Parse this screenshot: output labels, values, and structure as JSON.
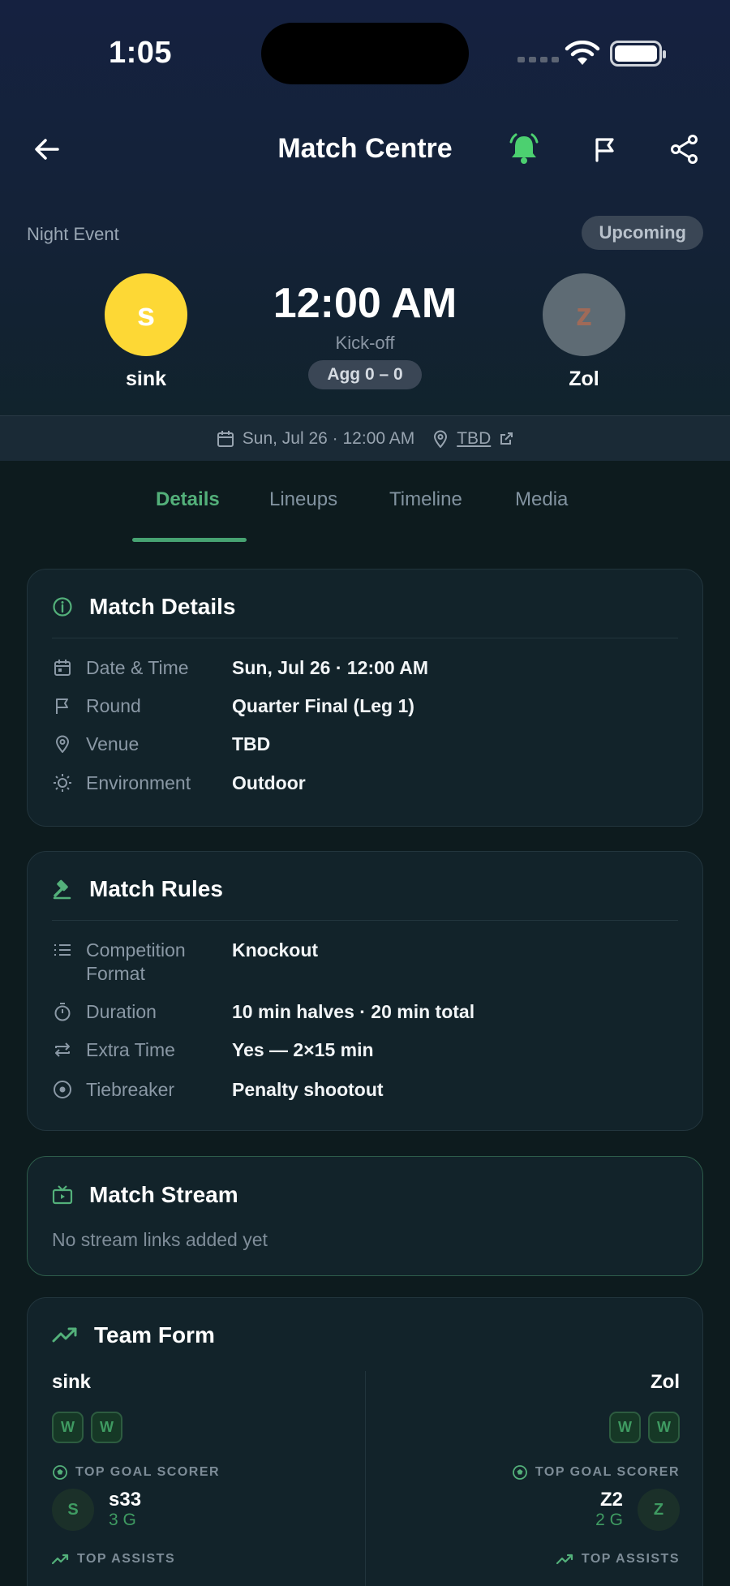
{
  "status_bar": {
    "time": "1:05"
  },
  "header": {
    "title": "Match Centre"
  },
  "hero": {
    "event_label": "Night Event",
    "status": "Upcoming",
    "home": {
      "initial": "s",
      "name": "sink",
      "crest_color": "#fdd835"
    },
    "away": {
      "initial": "z",
      "name": "Zol",
      "crest_color": "#5e6b74"
    },
    "kickoff_time": "12:00 AM",
    "kickoff_label": "Kick-off",
    "aggregate": "Agg 0 – 0"
  },
  "meta": {
    "datetime": "Sun, Jul 26 · 12:00 AM",
    "venue": "TBD"
  },
  "tabs": [
    {
      "label": "Details",
      "active": true
    },
    {
      "label": "Lineups"
    },
    {
      "label": "Timeline"
    },
    {
      "label": "Media"
    }
  ],
  "match_details": {
    "title": "Match Details",
    "rows": [
      {
        "label": "Date & Time",
        "value": "Sun, Jul 26 · 12:00 AM"
      },
      {
        "label": "Round",
        "value": "Quarter Final (Leg 1)"
      },
      {
        "label": "Venue",
        "value": "TBD"
      },
      {
        "label": "Environment",
        "value": "Outdoor"
      }
    ]
  },
  "match_rules": {
    "title": "Match Rules",
    "rows": [
      {
        "label": "Competition Format",
        "value": "Knockout"
      },
      {
        "label": "Duration",
        "value": "10 min halves · 20 min total"
      },
      {
        "label": "Extra Time",
        "value": "Yes — 2×15 min"
      },
      {
        "label": "Tiebreaker",
        "value": "Penalty shootout"
      }
    ]
  },
  "match_stream": {
    "title": "Match Stream",
    "empty": "No stream links added yet"
  },
  "team_form": {
    "title": "Team Form",
    "home": {
      "name": "sink",
      "form": [
        "W",
        "W"
      ],
      "scorer_label": "TOP GOAL SCORER",
      "scorer": {
        "initial": "S",
        "name": "s33",
        "goals": "3 G"
      },
      "assists_label": "TOP ASSISTS"
    },
    "away": {
      "name": "Zol",
      "form": [
        "W",
        "W"
      ],
      "scorer_label": "TOP GOAL SCORER",
      "scorer": {
        "initial": "Z",
        "name": "Z2",
        "goals": "2 G"
      },
      "assists_label": "TOP ASSISTS"
    }
  },
  "colors": {
    "accent": "#53b07a",
    "bell": "#4cd070"
  }
}
